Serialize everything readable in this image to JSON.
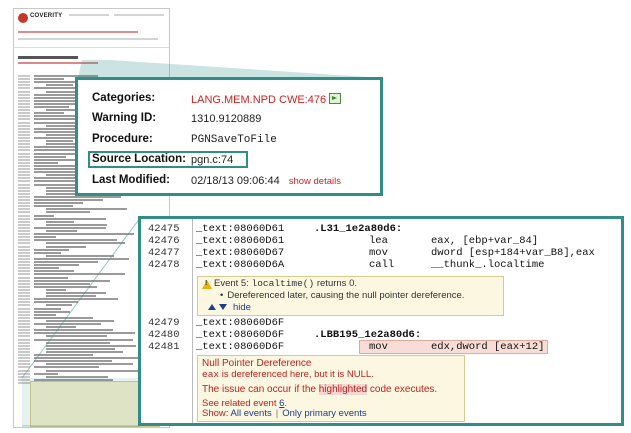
{
  "thumbnail": {
    "logo": "COVERITY"
  },
  "details": {
    "fields": [
      {
        "label": "Categories:",
        "value": "LANG.MEM.NPD CWE:476"
      },
      {
        "label": "Warning ID:",
        "value": "1310.9120889"
      },
      {
        "label": "Procedure:",
        "value": "PGNSaveToFile"
      },
      {
        "label": "Source Location:",
        "value": "pgn.c:74"
      },
      {
        "label": "Last Modified:",
        "value": "02/18/13 09:06:44"
      }
    ],
    "show_details": "show details"
  },
  "code": {
    "lines": [
      {
        "num": "42475",
        "addr": "_text:08060D61",
        "label": ".L31_1e2a80d6:",
        "mnemonic": "",
        "operands": ""
      },
      {
        "num": "42476",
        "addr": "_text:08060D61",
        "label": "",
        "mnemonic": "lea",
        "operands": "eax, [ebp+var_84]"
      },
      {
        "num": "42477",
        "addr": "_text:08060D67",
        "label": "",
        "mnemonic": "mov",
        "operands": "dword [esp+184+var_B8],eax"
      },
      {
        "num": "42478",
        "addr": "_text:08060D6A",
        "label": "",
        "mnemonic": "call",
        "operands": "__thunk_.localtime"
      },
      {
        "num": "42479",
        "addr": "_text:08060D6F",
        "label": "",
        "mnemonic": "",
        "operands": ""
      },
      {
        "num": "42480",
        "addr": "_text:08060D6F",
        "label": ".LBB195_1e2a80d6:",
        "mnemonic": "",
        "operands": ""
      },
      {
        "num": "42481",
        "addr": "_text:08060D6F",
        "label": "",
        "mnemonic": "mov",
        "operands": "edx,dword [eax+12]"
      }
    ],
    "event": {
      "title_prefix": "Event 5:",
      "title_code": "localtime()",
      "title_suffix": "returns 0.",
      "bullet": "Dereferenced later, causing the null pointer dereference.",
      "hide": "hide"
    },
    "issue": {
      "title": "Null Pointer Dereference",
      "line_code": "eax",
      "line_rest": "is dereferenced here, but it is NULL.",
      "exec_prefix": "The issue can occur if the",
      "exec_highlight": "highlighted",
      "exec_suffix": "code executes.",
      "related_prefix": "See related event",
      "related_event": "6",
      "related_suffix": ".",
      "show_label": "Show:",
      "all_events": "All events",
      "separator": "|",
      "primary_events": "Only primary events"
    }
  },
  "colors": {
    "teal_border": "#2f8f86",
    "red_link": "#d21f1f",
    "note_bg": "#fbf7e1",
    "highlight": "#f7ddd5",
    "blue_link": "#1f3d8c"
  }
}
